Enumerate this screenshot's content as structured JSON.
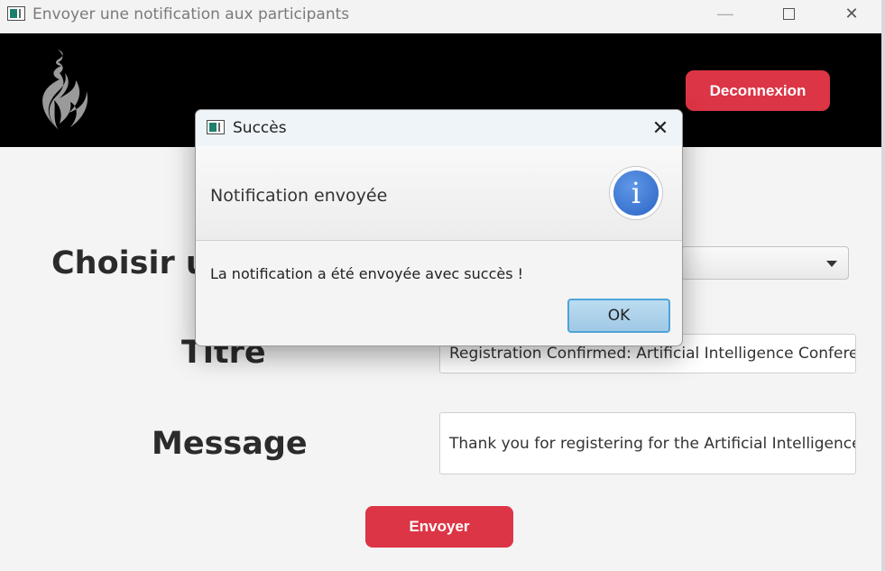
{
  "window": {
    "title": "Envoyer une notification aux participants",
    "minimize_icon": "—",
    "close_icon": "✕"
  },
  "header": {
    "logout_label": "Deconnexion",
    "accent": "#dc3545"
  },
  "form": {
    "choose_label": "Choisir un",
    "title_label": "Titre",
    "title_value": "Registration Confirmed: Artificial Intelligence Conferenc",
    "message_label": "Message",
    "message_value": "Thank you for registering for the Artificial Intelligence C",
    "send_label": "Envoyer"
  },
  "dialog": {
    "title": "Succès",
    "close_icon": "✕",
    "header_text": "Notification envoyée",
    "info_glyph": "i",
    "content": "La notification a été envoyée avec succès !",
    "ok_label": "OK"
  }
}
